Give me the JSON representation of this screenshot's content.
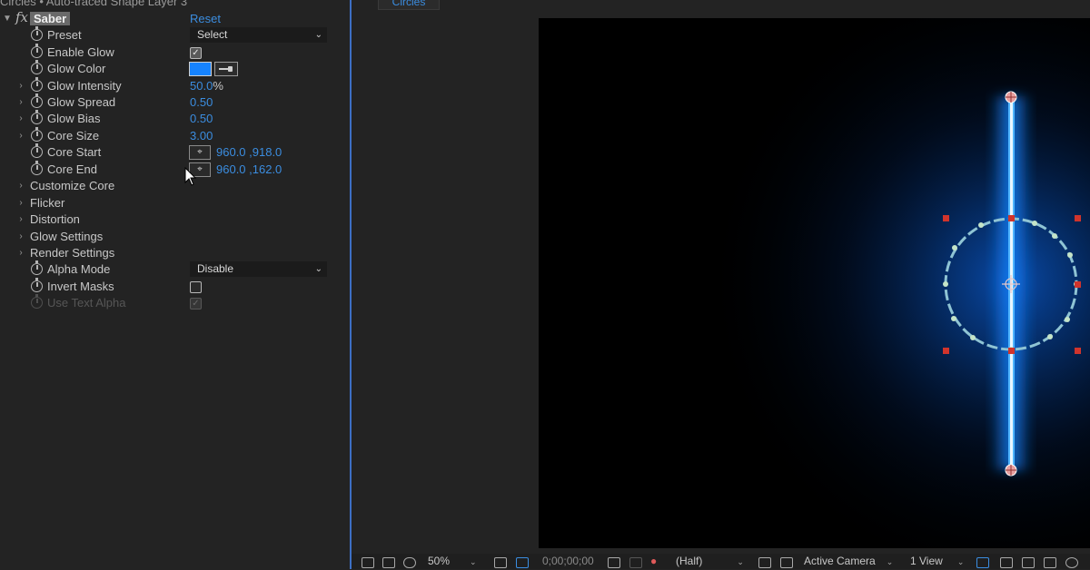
{
  "effect_panel": {
    "header": "Circles • Auto-traced Shape Layer 3",
    "effect_name": "Saber",
    "fx_label": "fx",
    "reset_label": "Reset",
    "properties": [
      {
        "label": "Preset",
        "value": "Select"
      },
      {
        "label": "Enable Glow",
        "checked": true
      },
      {
        "label": "Glow Color",
        "color": "#1683ff"
      },
      {
        "label": "Glow Intensity",
        "value": "50.0",
        "unit": "%"
      },
      {
        "label": "Glow Spread",
        "value": "0.50"
      },
      {
        "label": "Glow Bias",
        "value": "0.50"
      },
      {
        "label": "Core Size",
        "value": "3.00"
      },
      {
        "label": "Core Start",
        "value": "960.0 ,918.0"
      },
      {
        "label": "Core End",
        "value": "960.0 ,162.0"
      },
      {
        "label": "Customize Core"
      },
      {
        "label": "Flicker"
      },
      {
        "label": "Distortion"
      },
      {
        "label": "Glow Settings"
      },
      {
        "label": "Render Settings"
      },
      {
        "label": "Alpha Mode",
        "value": "Disable"
      },
      {
        "label": "Invert Masks",
        "checked": false
      },
      {
        "label": "Use Text Alpha",
        "checked": true,
        "disabled": true
      }
    ]
  },
  "viewer": {
    "tab_label": "Circles",
    "glow_color": "#1683ff",
    "toolbar": {
      "zoom": "50%",
      "timecode": "0;00;00;00",
      "resolution": "(Half)",
      "camera": "Active Camera",
      "views": "1 View"
    }
  },
  "colors": {
    "accent_blue": "#3b8de0",
    "panel_bg": "#232323",
    "divider": "#3d6fc4"
  }
}
